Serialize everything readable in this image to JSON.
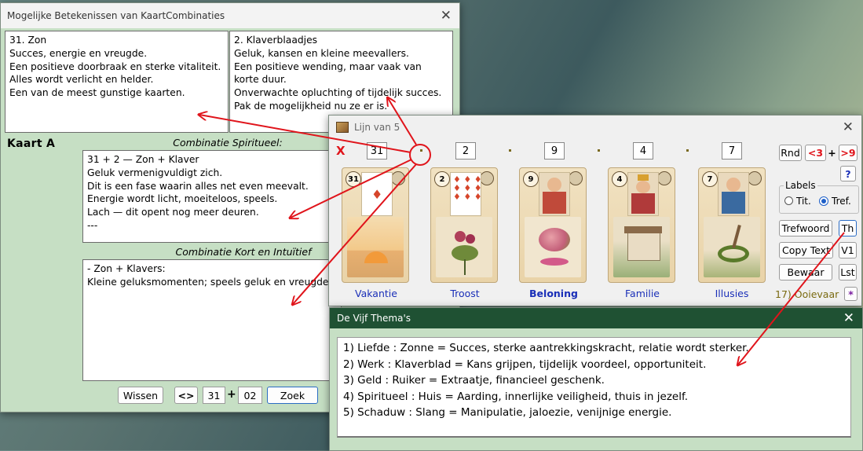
{
  "colors": {
    "main_window_bg": "#c6dfc4",
    "lijn_window_bg": "#f0f0f0",
    "themes_title_bg": "#1f5133",
    "themes_window_bg": "#c6dfc4",
    "annotation_red": "#e0141b",
    "label_blue": "#1a2fb8"
  },
  "main_window": {
    "title": "Mogelijke Betekenissen van KaartCombinaties",
    "close": "✕",
    "card_a_text": "31. Zon\nSucces, energie en vreugde.\nEen positieve doorbraak en sterke vitaliteit.\nAlles wordt verlicht en helder.\nEen van de meest gunstige kaarten.",
    "card_b_text": "2. Klaverblaadjes\nGeluk, kansen en kleine meevallers.\nEen positieve wending, maar vaak van korte duur.\nOnverwachte opluchting of tijdelijk succes.\nPak de mogelijkheid nu ze er is.",
    "kaart_label": "Kaart A",
    "spiritueel_heading": "Combinatie Spiritueel:",
    "spiritueel_text": "31 + 2 — Zon + Klaver\nGeluk vermenigvuldigt zich.\nDit is een fase waarin alles net even meevalt.\nEnergie wordt licht, moeiteloos, speels.\nLach — dit opent nog meer deuren.\n---",
    "kort_heading": "Combinatie Kort en Intuïtief",
    "kort_text": "- Zon + Klavers:\nKleine geluksmomenten; speels geluk en vreugde.",
    "wissen": "Wissen",
    "swap": "<>",
    "card_num_a": "31",
    "plus": "+",
    "card_num_b": "02",
    "zoek": "Zoek"
  },
  "lijn_window": {
    "title": "Lijn van 5",
    "close": "✕",
    "x_mark": "X",
    "numbers": [
      "31",
      "2",
      "9",
      "4",
      "7"
    ],
    "cards": [
      {
        "number": "31",
        "label": "Vakantie",
        "bold": false,
        "art": "sun-sunrise"
      },
      {
        "number": "2",
        "label": "Troost",
        "bold": false,
        "art": "clover-flowers"
      },
      {
        "number": "9",
        "label": "Beloning",
        "bold": true,
        "art": "bouquet"
      },
      {
        "number": "4",
        "label": "Familie",
        "bold": false,
        "art": "house"
      },
      {
        "number": "7",
        "label": "Illusies",
        "bold": false,
        "art": "snake"
      }
    ],
    "rnd": "Rnd",
    "lt3": "<3",
    "plus": "+",
    "gt9": ">9",
    "help": "?",
    "labels_group": "Labels",
    "radio_tit": "Tit.",
    "radio_tref": "Tref.",
    "radio_selected": "Tref.",
    "trefwoord": "Trefwoord",
    "th": "Th",
    "copy_text": "Copy Text",
    "v1": "V1",
    "bewaar": "Bewaar",
    "lst": "Lst",
    "extra_label": "17) Ooievaar",
    "star": "*"
  },
  "themes_window": {
    "title": "De Vijf Thema's",
    "close": "✕",
    "lines": [
      "1) Liefde : Zonne = Succes, sterke aantrekkingskracht, relatie wordt sterker.",
      "2) Werk : Klaverblad = Kans grijpen, tijdelijk voordeel, opportuniteit.",
      "3) Geld : Ruiker = Extraatje, financieel geschenk.",
      "4) Spiritueel : Huis = Aarding, innerlijke veiligheid, thuis in jezelf.",
      "5) Schaduw : Slang = Manipulatie, jaloezie, venijnige energie."
    ]
  },
  "icons": {
    "card_deck_icon": "card-deck-icon"
  }
}
